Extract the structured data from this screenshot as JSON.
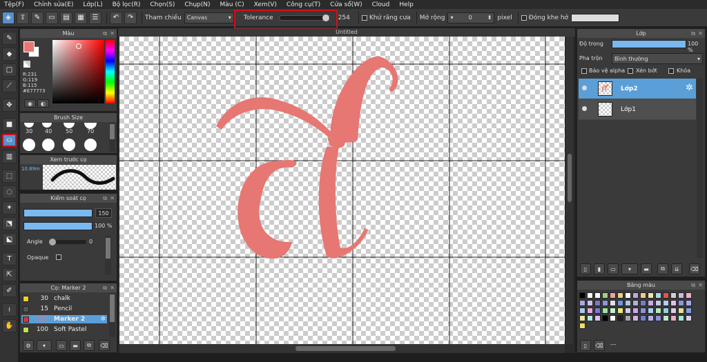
{
  "menubar": {
    "items": [
      "Tệp(F)",
      "Chỉnh sửa(E)",
      "Lớp(L)",
      "Bộ lọc(R)",
      "Chọn(S)",
      "Chụp(N)",
      "Màu (C)",
      "Xem(V)",
      "Công cụ(T)",
      "Cửa sổ(W)",
      "Cloud",
      "Help"
    ]
  },
  "toolbar": {
    "reference_label": "Tham chiếu",
    "reference_value": "Canvas",
    "tolerance_label": "Tolerance",
    "tolerance_value": "254",
    "tolerance_fraction": 0.95,
    "antialias_label": "Khử răng cưa",
    "expand_label": "Mở rộng",
    "expand_value": "0",
    "expand_unit": "pixel",
    "close_gap_label": "Đóng khe hở"
  },
  "color_panel": {
    "title": "Màu",
    "fg_color": "#E77773",
    "r_label": "R:231",
    "g_label": "G:119",
    "b_label": "B:115",
    "hex_label": "#E77773"
  },
  "brush_size_panel": {
    "title": "Brush Size",
    "sizes": [
      "30",
      "40",
      "50",
      "70"
    ]
  },
  "preview_panel": {
    "title": "Xem trước cọ",
    "size_label": "10.89m"
  },
  "brush_control": {
    "title": "Kiểm soát cọ",
    "size_value": "150",
    "opacity_value": "100 %",
    "angle_label": "Angle",
    "angle_value": "0",
    "opaque_label": "Opaque"
  },
  "brush_list": {
    "title": "Cọ: Marker 2",
    "items": [
      {
        "size": "30",
        "name": "chalk",
        "color": "#f0d020"
      },
      {
        "size": "15",
        "name": "Pencil",
        "color": "#555555"
      },
      {
        "size": "150",
        "name": "Marker 2",
        "color": "#e03030"
      },
      {
        "size": "100",
        "name": "Soft Pastel",
        "color": "#c0e050"
      }
    ]
  },
  "canvas": {
    "title": "Untitled",
    "letter_color": "#E77773"
  },
  "layer_panel": {
    "title": "Lớp",
    "opacity_label": "Độ trong",
    "opacity_value": "100 %",
    "blend_label": "Pha trộn",
    "blend_value": "Bình thường",
    "protect_alpha_label": "Bảo vệ alpha",
    "clip_label": "Xén bớt",
    "lock_label": "Khóa",
    "layers": [
      {
        "name": "Lớp2",
        "selected": true
      },
      {
        "name": "Lớp1",
        "selected": false
      }
    ]
  },
  "palette_panel": {
    "title": "Bảng màu",
    "footer_text": "---",
    "rows": [
      [
        "#000000",
        "#ffffff",
        "#ffffff",
        "#9ed08a",
        "#f3a0a0",
        "#e8d08a",
        "#ffffff",
        "#b8a8e8",
        "#f5c890",
        "#e8e8b0",
        "#a8d8e8",
        "#e85050",
        "#d0d0d0",
        "#c8b8e8",
        "#f0b0c8"
      ],
      [
        "#a8a8e8",
        "#d0c0f0",
        "#7878c8",
        "#8898d8",
        "#e0e0e0",
        "#7098d8",
        "#a8c8e8",
        "#b0b0d0",
        "#7080c0",
        "#d0a8e8",
        "#c8c8e8",
        "#b0d0f0",
        "#e0c0e8",
        "#8898e0",
        "#a8a8f0"
      ],
      [
        "#b0c8f0",
        "#e8a8d8",
        "#7878e0",
        "#a0e0a0",
        "#c0f0d0",
        "#e8e880",
        "#d0d0f0",
        "#c8a8e8",
        "#9090d8",
        "#a8d0f0",
        "#b8e8b8",
        "#90d0e8",
        "#e8c8e8",
        "#e0e0a0",
        "#80a0e0"
      ],
      [
        "#e8e8a0",
        "#b0e8e8",
        "#e0c0f0",
        "#000000",
        "#ffffff",
        "#202020",
        "#a8a8a8",
        "#d0b0e8",
        "#7080d0",
        "#b0b0e8",
        "#9090e0",
        "#c0e8c0",
        "#e8b0c0",
        "#a0e8d0",
        "#d8d0f0"
      ],
      [
        "#f0e060"
      ]
    ]
  }
}
